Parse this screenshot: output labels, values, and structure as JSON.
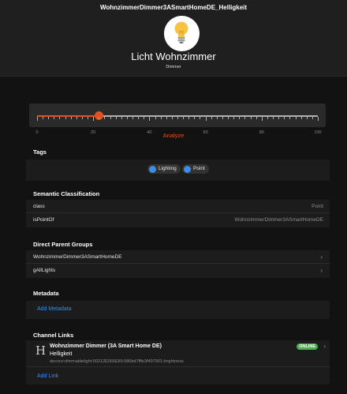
{
  "header": {
    "item_name": "WohnzimmerDimmer3ASmartHomeDE_Helligkeit",
    "label": "Licht Wohnzimmer",
    "type": "Dimmer",
    "icon": "lightbulb-icon"
  },
  "slider": {
    "value": 22,
    "min": 0,
    "max": 100,
    "tick_labels": [
      "0",
      "20",
      "40",
      "60",
      "80",
      "100"
    ],
    "accent_color": "#e0531e"
  },
  "analyze_label": "Analyze",
  "tags": {
    "title": "Tags",
    "items": [
      "Lighting",
      "Point"
    ]
  },
  "semantic": {
    "title": "Semantic Classification",
    "rows": [
      {
        "key": "class",
        "value": "Point"
      },
      {
        "key": "isPointOf",
        "value": "WohnzimmerDimmer3ASmartHomeDE"
      }
    ]
  },
  "groups": {
    "title": "Direct Parent Groups",
    "items": [
      "WohnzimmerDimmer3ASmartHomeDE",
      "gAllLights"
    ]
  },
  "metadata": {
    "title": "Metadata",
    "add_label": "Add Metadata"
  },
  "channels": {
    "title": "Channel Links",
    "link": {
      "icon_letter": "H",
      "thing": "Wohnzimmer Dimmer (3A Smart Home DE)",
      "channel": "Helligkeit",
      "uid": "deconz:dimmablelight:00212E065E85:086bd7fffe3f497901:brightness",
      "status": "ONLINE"
    },
    "add_label": "Add Link"
  },
  "colors": {
    "blue": "#3a8ee6",
    "online": "#4caf50"
  }
}
